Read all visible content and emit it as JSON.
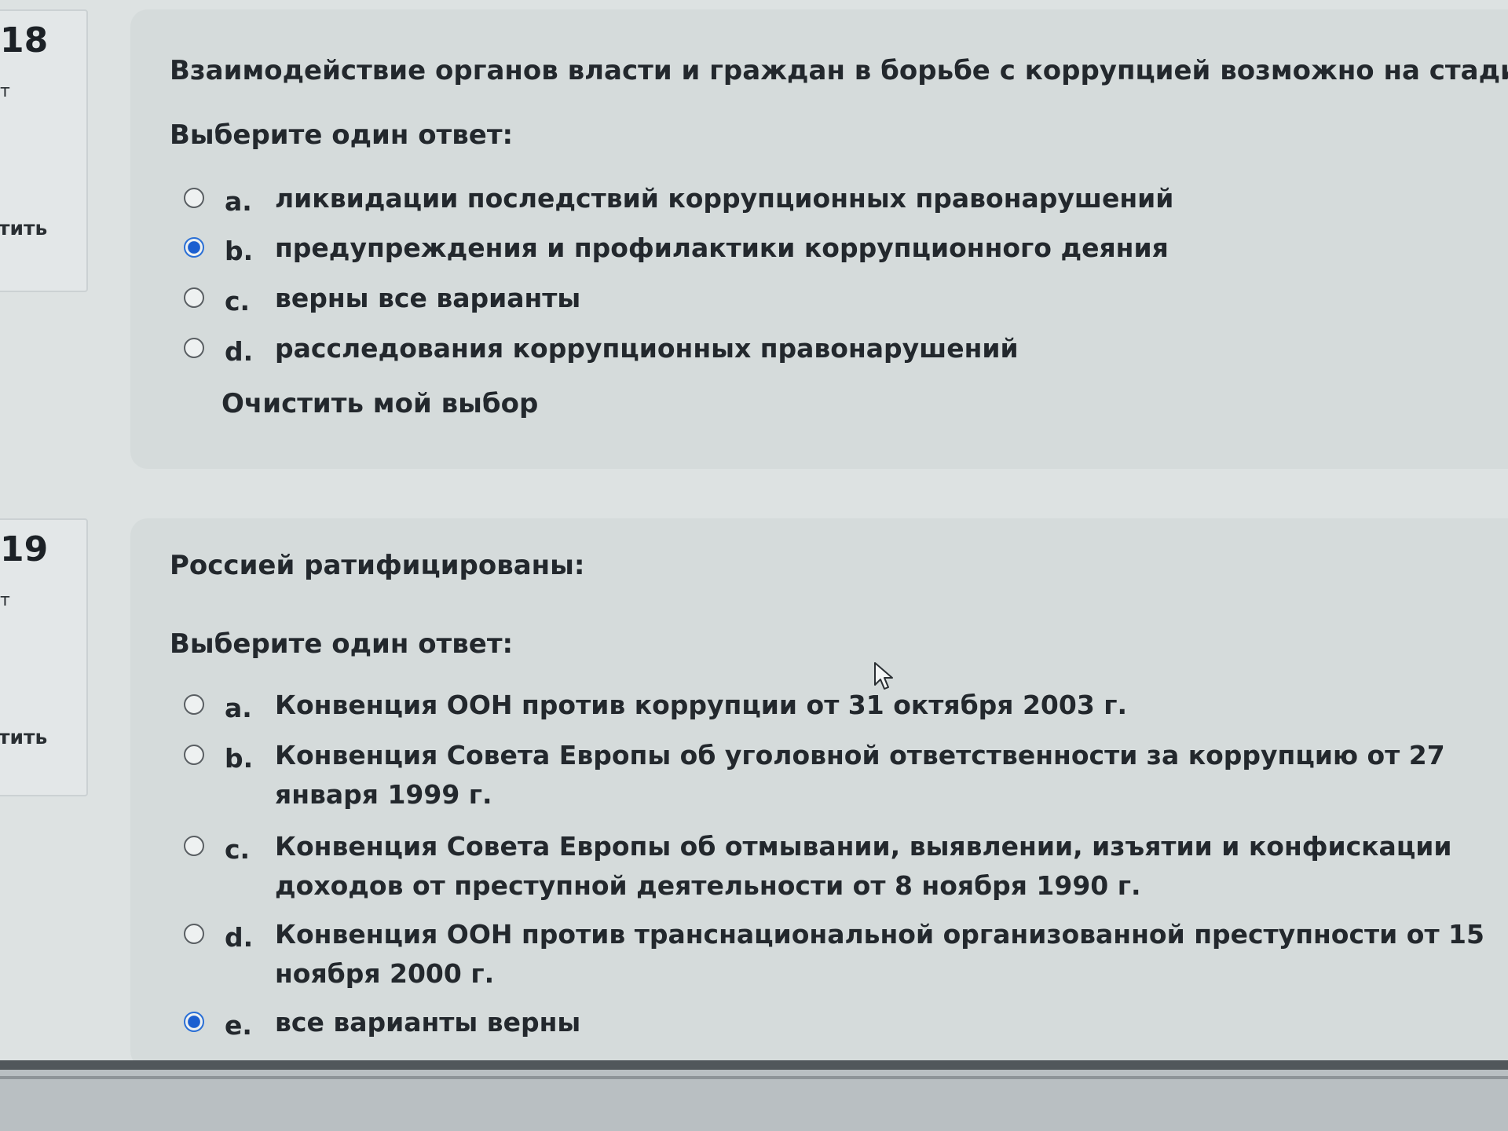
{
  "questions": [
    {
      "number": "18",
      "state_fragment": "т",
      "flag_fragment": "тить",
      "text": "Взаимодействие органов власти и граждан в борьбе с коррупцией возможно на стадии:",
      "prompt": "Выберите один ответ:",
      "answers": [
        {
          "letter": "a.",
          "text": "ликвидации последствий коррупционных правонарушений",
          "selected": false
        },
        {
          "letter": "b.",
          "text": "предупреждения и профилактики коррупционного деяния",
          "selected": true
        },
        {
          "letter": "c.",
          "text": "верны все варианты",
          "selected": false
        },
        {
          "letter": "d.",
          "text": "расследования коррупционных правонарушений",
          "selected": false
        }
      ],
      "clear_choice": "Очистить мой выбор"
    },
    {
      "number": "19",
      "state_fragment": "т",
      "flag_fragment": "тить",
      "text": "Россией ратифицированы:",
      "prompt": "Выберите один ответ:",
      "answers": [
        {
          "letter": "a.",
          "text": "Конвенция ООН против коррупции от 31 октября 2003 г.",
          "selected": false
        },
        {
          "letter": "b.",
          "text": "Конвенция Совета Европы об уголовной ответственности за коррупцию от 27 января 1999 г.",
          "selected": false
        },
        {
          "letter": "c.",
          "text": "Конвенция Совета Европы об отмывании, выявлении, изъятии и конфискации доходов от преступной деятельности от 8 ноября 1990 г.",
          "selected": false
        },
        {
          "letter": "d.",
          "text": "Конвенция ООН против транснациональной организованной преступности от 15 ноября 2000 г.",
          "selected": false
        },
        {
          "letter": "e.",
          "text": "все варианты верны",
          "selected": true
        }
      ]
    }
  ],
  "colors": {
    "background": "#dde2e2",
    "question_card": "#d5dbdb",
    "radio_selected": "#1c5fd0"
  }
}
